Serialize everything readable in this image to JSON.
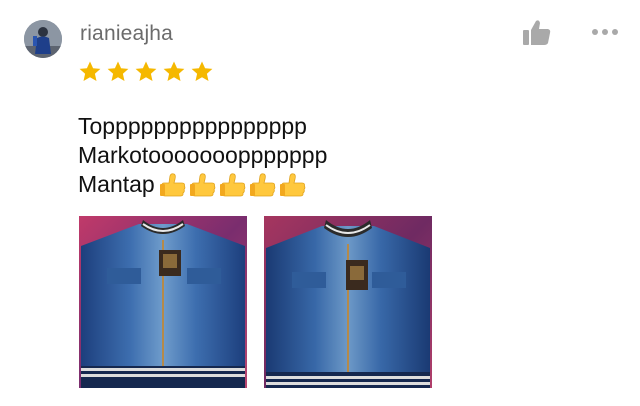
{
  "review": {
    "username": "rianieajha",
    "rating": 5,
    "rating_max": 5,
    "text_lines": [
      "Topppppppppppppppp",
      "Markotoooooooppppppp",
      "Mantap"
    ],
    "thumbs_emoji_count": 5
  },
  "photos": [
    {
      "name": "review-photo-1",
      "subject": "denim jacket"
    },
    {
      "name": "review-photo-2",
      "subject": "denim jacket"
    }
  ],
  "icons": {
    "like": "thumbs-up-icon",
    "more": "more-dots-icon",
    "star": "star-icon",
    "thumb_emoji": "thumbs-up-emoji-icon"
  },
  "colors": {
    "star": "#F5B800",
    "username": "#6B6B6B",
    "icon_gray": "#A9A9A9",
    "thumb_emoji": "#FFC83D",
    "text": "#111111"
  }
}
